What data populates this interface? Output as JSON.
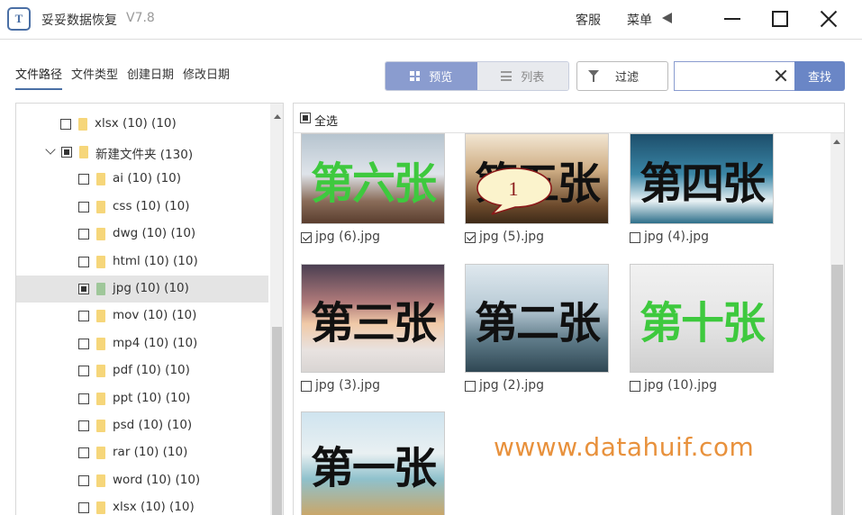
{
  "window": {
    "app_name": "妥妥数据恢复",
    "version": "V7.8",
    "links": {
      "service": "客服",
      "menu": "菜单"
    }
  },
  "tabs": [
    "文件路径",
    "文件类型",
    "创建日期",
    "修改日期"
  ],
  "view": {
    "preview": "预览",
    "list": "列表",
    "selected": "preview"
  },
  "filter_label": "过滤",
  "search": {
    "value": "",
    "button": "查找"
  },
  "tree": {
    "items": [
      {
        "label": "xlsx (10)  (10)",
        "checked": "unchecked"
      },
      {
        "label": "新建文件夹  (130)",
        "checked": "partial",
        "expanded": true
      },
      {
        "label": "ai (10)  (10)",
        "checked": "unchecked"
      },
      {
        "label": "css (10)  (10)",
        "checked": "unchecked"
      },
      {
        "label": "dwg (10)  (10)",
        "checked": "unchecked"
      },
      {
        "label": "html (10)  (10)",
        "checked": "unchecked"
      },
      {
        "label": "jpg (10)  (10)",
        "checked": "partial",
        "selected": true
      },
      {
        "label": "mov (10)  (10)",
        "checked": "unchecked"
      },
      {
        "label": "mp4 (10)  (10)",
        "checked": "unchecked"
      },
      {
        "label": "pdf (10)  (10)",
        "checked": "unchecked"
      },
      {
        "label": "ppt (10)  (10)",
        "checked": "unchecked"
      },
      {
        "label": "psd (10)  (10)",
        "checked": "unchecked"
      },
      {
        "label": "rar (10)  (10)",
        "checked": "unchecked"
      },
      {
        "label": "word (10)  (10)",
        "checked": "unchecked"
      },
      {
        "label": "xlsx (10)  (10)",
        "checked": "unchecked"
      }
    ]
  },
  "content": {
    "select_all": "全选",
    "files": [
      {
        "name": "jpg (6).jpg",
        "image_text": "第六张",
        "checked": true
      },
      {
        "name": "jpg (5).jpg",
        "image_text": "第五张",
        "checked": true
      },
      {
        "name": "jpg (4).jpg",
        "image_text": "第四张",
        "checked": false
      },
      {
        "name": "jpg (3).jpg",
        "image_text": "第三张",
        "checked": false
      },
      {
        "name": "jpg (2).jpg",
        "image_text": "第二张",
        "checked": false
      },
      {
        "name": "jpg (10).jpg",
        "image_text": "第十张",
        "checked": false
      },
      {
        "name": "",
        "image_text": "第一张",
        "checked": false
      }
    ],
    "watermark": "wwww.datahuif.com",
    "callout": "1"
  },
  "colors": {
    "accent": "#4a6fa5",
    "search_button": "#6a86c6",
    "view_toggle_on": "#8a9ccf",
    "watermark": "#e8913c",
    "image_text_green": "#3ec93e",
    "image_text_black": "#111111",
    "callout_fill": "#fbf3cc",
    "callout_text": "#8b1a1a"
  }
}
